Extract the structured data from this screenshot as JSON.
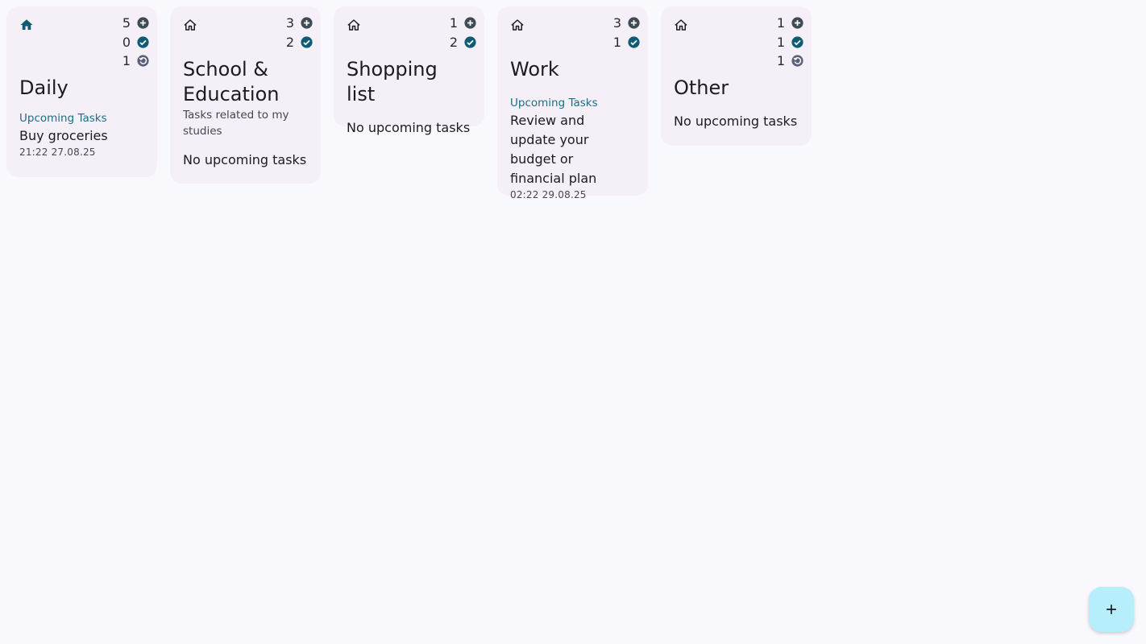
{
  "colors": {
    "accent": "#0d5c74",
    "card_bg": "#f5eff7",
    "page_bg": "#f9f9fd",
    "upcoming_label": "#1f6e84",
    "fab_bg": "#b7eefb"
  },
  "categories": [
    {
      "icon": "home-filled-icon",
      "title": "Daily",
      "description": "",
      "counts": {
        "open": "5",
        "done": "0",
        "recurring": "1"
      },
      "upcoming_label": "Upcoming Tasks",
      "task_title": "Buy groceries",
      "task_time": "21:22 27.08.25"
    },
    {
      "icon": "home-outline-icon",
      "title": "School & Education",
      "description": "Tasks related to my studies",
      "counts": {
        "open": "3",
        "done": "2"
      },
      "empty_label": "No upcoming tasks"
    },
    {
      "icon": "home-outline-icon",
      "title": "Shopping list",
      "counts": {
        "open": "1",
        "done": "2"
      },
      "empty_label": "No upcoming tasks"
    },
    {
      "icon": "home-outline-icon",
      "title": "Work",
      "counts": {
        "open": "3",
        "done": "1"
      },
      "upcoming_label": "Upcoming Tasks",
      "task_title": "Review and update your budget or financial plan",
      "task_time": "02:22 29.08.25"
    },
    {
      "icon": "home-outline-icon",
      "title": "Other",
      "counts": {
        "open": "1",
        "done": "1",
        "recurring": "1"
      },
      "empty_label": "No upcoming tasks"
    }
  ],
  "fab": {
    "icon": "plus-icon"
  }
}
